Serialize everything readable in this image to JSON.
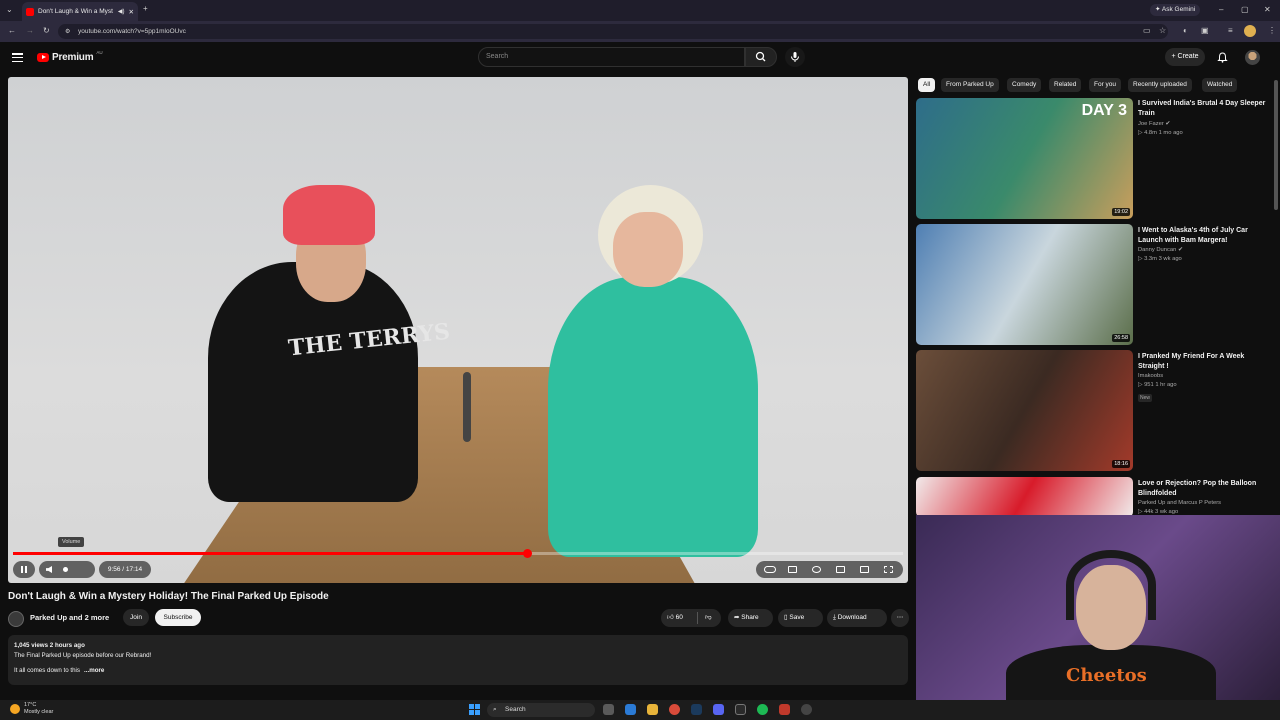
{
  "browser": {
    "tab_title": "Don't Laugh & Win a Myst",
    "url": "youtube.com/watch?v=5pp1mloOUvc",
    "ask_gemini": "Ask Gemini"
  },
  "header": {
    "logo_text": "Premium",
    "logo_country": "AU",
    "search_placeholder": "Search",
    "create_label": "Create"
  },
  "player": {
    "tooltip": "Volume",
    "time": "9:56 / 17:14",
    "progress_fraction": 0.577,
    "shirt_text": "THE TERRYS"
  },
  "video": {
    "title": "Don't Laugh & Win a Mystery Holiday! The Final Parked Up Episode",
    "channel": "Parked Up and 2 more",
    "join": "Join",
    "subscribe": "Subscribe",
    "likes": "60",
    "share": "Share",
    "save": "Save",
    "download": "Download",
    "more": "⋯",
    "views_line": "1,045 views  2 hours ago",
    "desc_line1": "The Final Parked Up episode before our Rebrand!",
    "desc_line2": "It all comes down to this",
    "desc_more": "...more"
  },
  "chips": [
    "All",
    "From Parked Up",
    "Comedy",
    "Related",
    "For you",
    "Recently uploaded",
    "Watched"
  ],
  "recommendations": [
    {
      "title": "I Survived India's Brutal 4 Day Sleeper Train",
      "channel": "Joe Fazer ✔",
      "meta": "▷ 4.8m  1 mo ago",
      "duration": "19:02",
      "overlay": "DAY 3",
      "colors": [
        "#2e6d8a",
        "#3a8a6b",
        "#c99e5c"
      ]
    },
    {
      "title": "I Went to Alaska's 4th of July Car Launch with Bam Margera!",
      "channel": "Danny Duncan ✔",
      "meta": "▷ 3.3m  3 wk ago",
      "duration": "26:58",
      "overlay": "",
      "colors": [
        "#4f7fb3",
        "#c9d6dd",
        "#5b6e4a"
      ]
    },
    {
      "title": "I Pranked My Friend For A Week Straight !",
      "channel": "Imakoobs",
      "meta": "▷ 951  1 hr ago",
      "duration": "18:16",
      "badge": "New",
      "overlay": "",
      "colors": [
        "#6b4e3a",
        "#3b2a22",
        "#a33a2a"
      ]
    },
    {
      "title": "Love or Rejection? Pop the Balloon Blindfolded",
      "channel": "Parked Up and Marcus P Peters",
      "meta": "▷ 44k  3 wk ago",
      "duration": "",
      "overlay": "",
      "colors": [
        "#f1eaea",
        "#d81b2a",
        "#f1eaea"
      ]
    }
  ],
  "webcam": {
    "shirt_text": "Cheetos"
  },
  "taskbar": {
    "temp": "17°C",
    "weather": "Mostly clear",
    "search": "Search"
  }
}
